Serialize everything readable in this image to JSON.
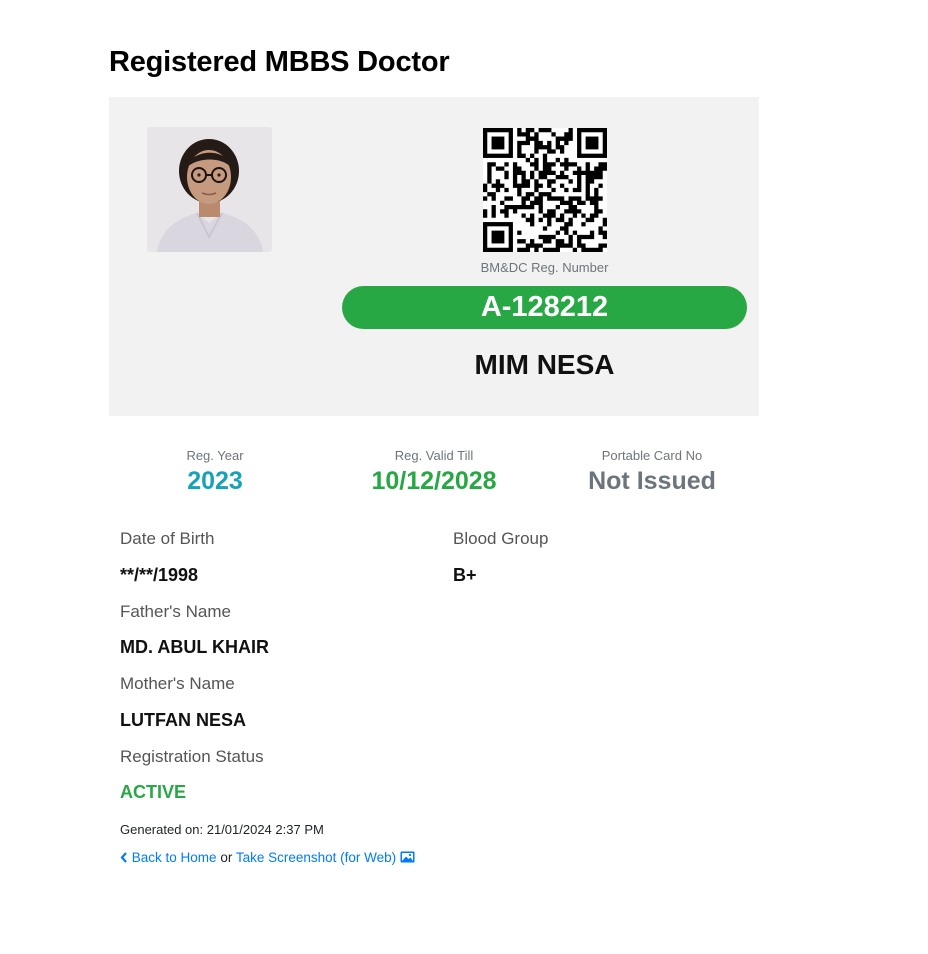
{
  "page": {
    "title": "Registered MBBS Doctor"
  },
  "card": {
    "photo_icon": "doctor-portrait",
    "qr_icon": "qr-code",
    "reg_label": "BM&DC Reg. Number",
    "reg_number": "A-128212",
    "doctor_name": "MIM NESA"
  },
  "stats": {
    "reg_year": {
      "label": "Reg. Year",
      "value": "2023",
      "color": "#17a2b8"
    },
    "valid_till": {
      "label": "Reg. Valid Till",
      "value": "10/12/2028",
      "color": "#28a745"
    },
    "portable_card": {
      "label": "Portable Card No",
      "value": "Not Issued",
      "color": "#6c757d"
    }
  },
  "details": {
    "dob": {
      "label": "Date of Birth",
      "value": "**/**/1998"
    },
    "blood": {
      "label": "Blood Group",
      "value": "B+"
    },
    "father": {
      "label": "Father's Name",
      "value": "MD. ABUL KHAIR"
    },
    "mother": {
      "label": "Mother's Name",
      "value": "LUTFAN NESA"
    },
    "status": {
      "label": "Registration Status",
      "value": "ACTIVE",
      "color": "#28a745"
    }
  },
  "footer": {
    "generated": "Generated on: 21/01/2024 2:37 PM",
    "back_label": "Back to Home",
    "or_text": "or",
    "screenshot_label": "Take Screenshot (for Web)",
    "back_icon": "chevron-left-icon",
    "screenshot_icon": "image-icon"
  }
}
